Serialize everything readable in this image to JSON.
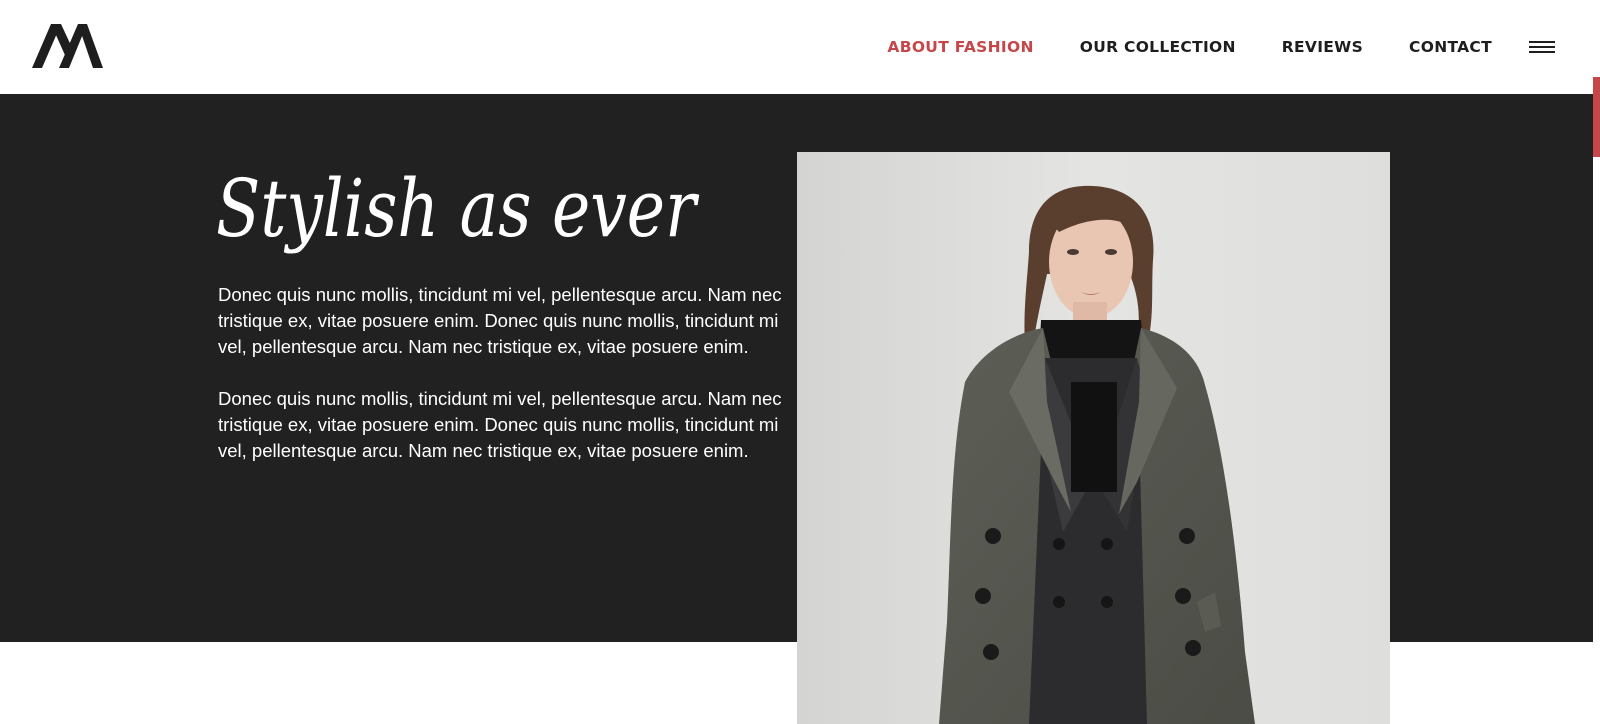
{
  "header": {
    "logo_icon": "brand-monogram-icon",
    "nav": [
      {
        "label": "ABOUT FASHION",
        "active": true
      },
      {
        "label": "OUR COLLECTION",
        "active": false
      },
      {
        "label": "REVIEWS",
        "active": false
      },
      {
        "label": "CONTACT",
        "active": false
      }
    ],
    "menu_icon": "hamburger-icon"
  },
  "hero": {
    "title": "Stylish as ever",
    "paragraphs": [
      "Donec quis nunc mollis, tincidunt mi vel, pellentesque arcu. Nam nec tristique ex, vitae posuere enim. Donec quis nunc mollis, tincidunt mi vel, pellentesque arcu. Nam nec tristique ex, vitae posuere enim.",
      "Donec quis nunc mollis, tincidunt mi vel, pellentesque arcu. Nam nec tristique ex, vitae posuere enim. Donec quis nunc mollis, tincidunt mi vel, pellentesque arcu. Nam nec tristique ex, vitae posuere enim."
    ]
  },
  "colors": {
    "accent": "#c5474a",
    "hero_background": "#212121",
    "nav_text": "#1e1e1e"
  }
}
